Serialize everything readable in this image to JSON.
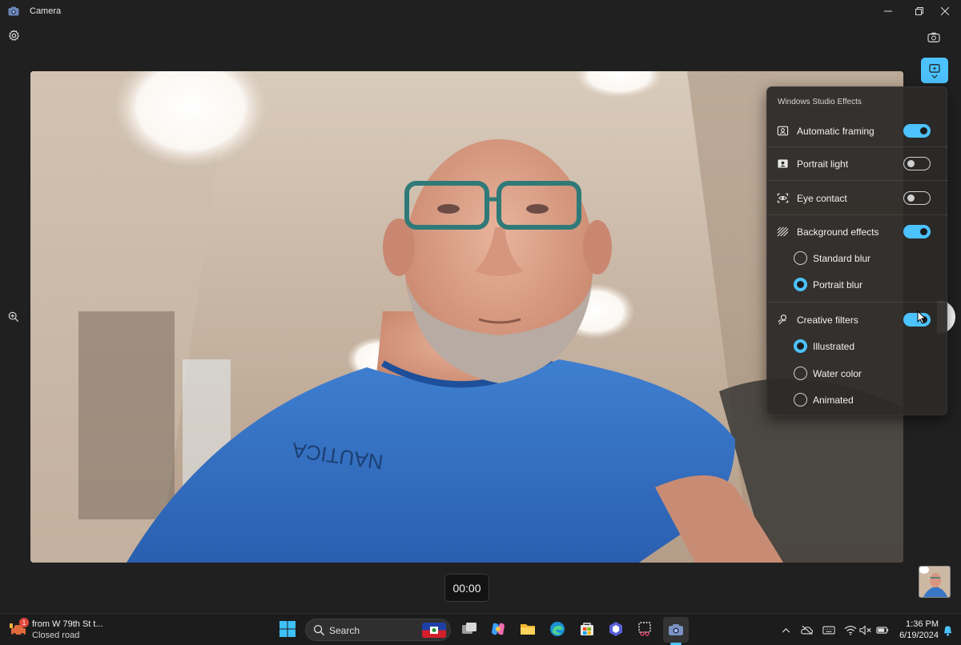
{
  "app": {
    "title": "Camera"
  },
  "effects_panel": {
    "title": "Windows Studio Effects",
    "items": [
      {
        "label": "Automatic framing",
        "icon": "framing-icon",
        "enabled": true
      },
      {
        "label": "Portrait light",
        "icon": "portrait-light-icon",
        "enabled": false
      },
      {
        "label": "Eye contact",
        "icon": "eye-contact-icon",
        "enabled": false
      },
      {
        "label": "Background effects",
        "icon": "background-effects-icon",
        "enabled": true
      },
      {
        "label": "Creative filters",
        "icon": "creative-filters-icon",
        "enabled": true
      }
    ],
    "background_options": [
      {
        "label": "Standard blur",
        "selected": false
      },
      {
        "label": "Portrait blur",
        "selected": true
      }
    ],
    "filter_options": [
      {
        "label": "Illustrated",
        "selected": true
      },
      {
        "label": "Water color",
        "selected": false
      },
      {
        "label": "Animated",
        "selected": false
      }
    ]
  },
  "recording": {
    "timer": "00:00"
  },
  "preview": {
    "shirt_text": "NAUTICA"
  },
  "taskbar": {
    "news": {
      "badge": "1",
      "title": "from W 79th St t...",
      "subtitle": "Closed road"
    },
    "search_placeholder": "Search",
    "clock": {
      "time": "1:36 PM",
      "date": "6/19/2024"
    }
  },
  "colors": {
    "accent": "#4cc2ff",
    "window_bg": "#202020",
    "panel_bg": "#2c2a28"
  }
}
